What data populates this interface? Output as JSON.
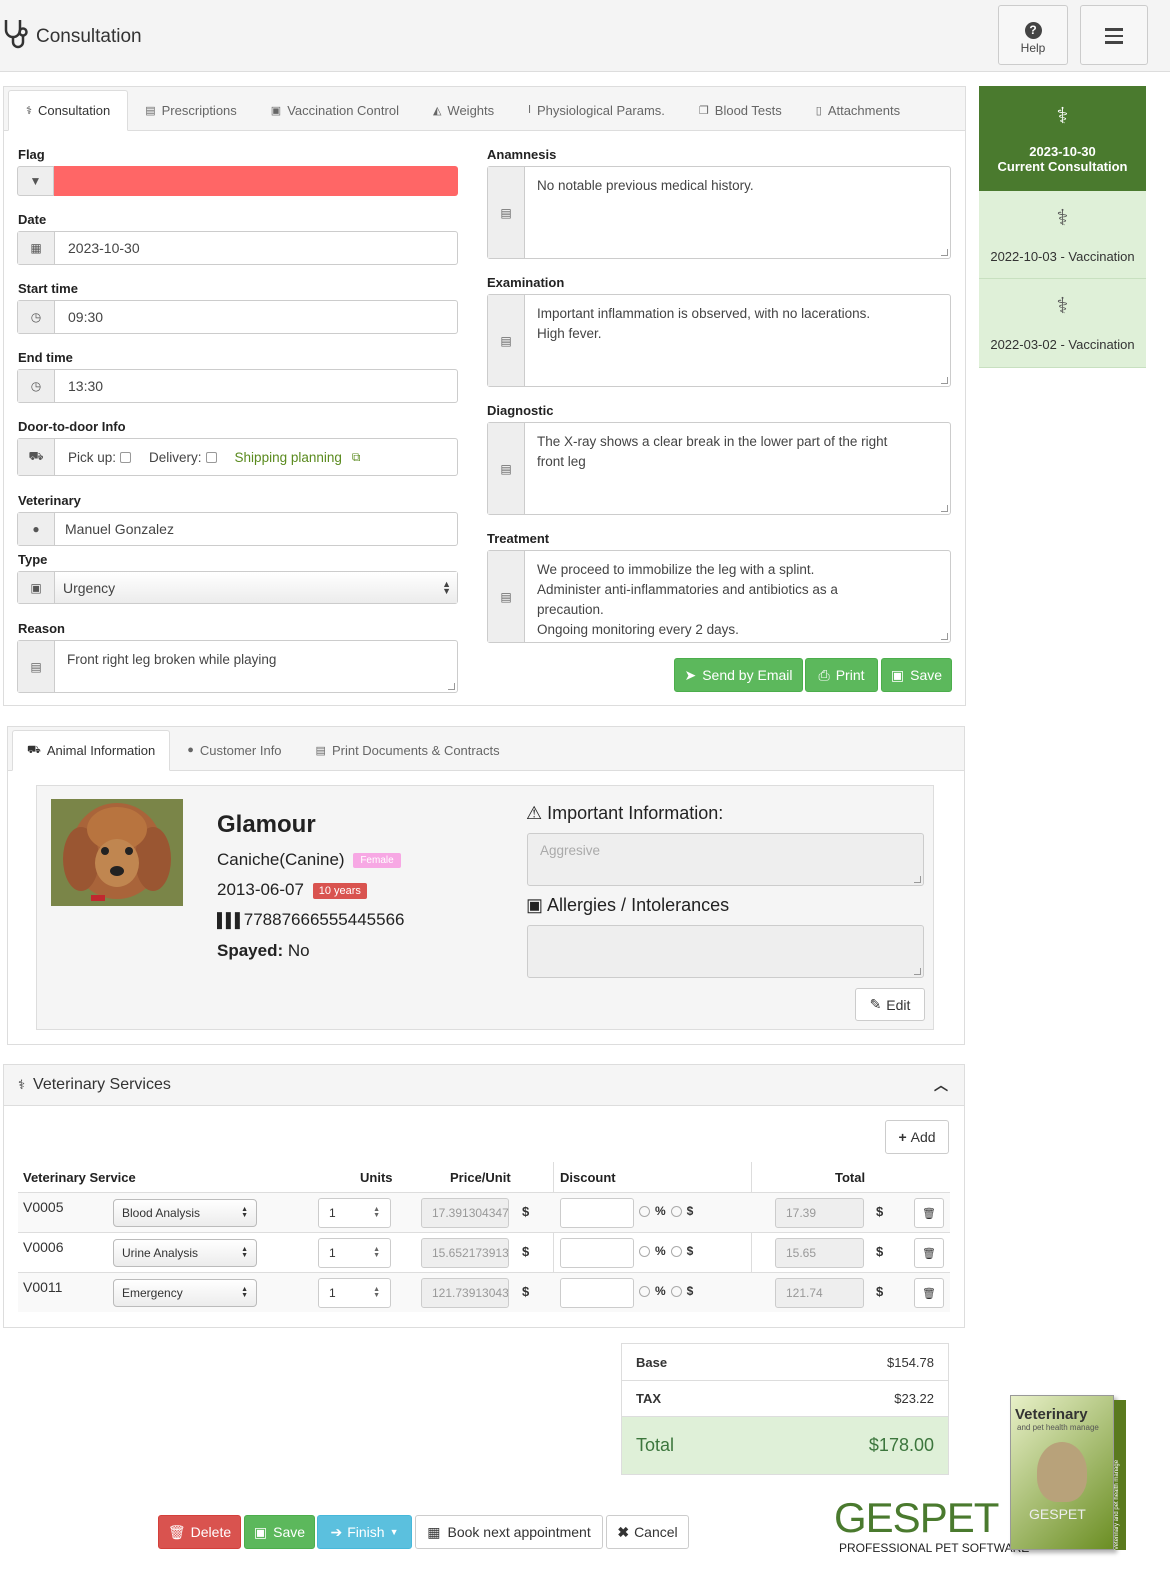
{
  "header": {
    "title": "Consultation",
    "help_label": "Help"
  },
  "tabs": [
    "Consultation",
    "Prescriptions",
    "Vaccination Control",
    "Weights",
    "Physiological Params.",
    "Blood Tests",
    "Attachments"
  ],
  "form": {
    "flag_label": "Flag",
    "flag_color": "#ff6666",
    "date_label": "Date",
    "date": "2023-10-30",
    "start_label": "Start time",
    "start": "09:30",
    "end_label": "End time",
    "end": "13:30",
    "door_label": "Door-to-door Info",
    "pickup_label": "Pick up:",
    "delivery_label": "Delivery:",
    "shipping_link": "Shipping planning",
    "vet_label": "Veterinary",
    "vet": "Manuel Gonzalez",
    "type_label": "Type",
    "type": "Urgency",
    "reason_label": "Reason",
    "reason": "Front right leg broken while playing"
  },
  "notes": {
    "anamnesis_label": "Anamnesis",
    "anamnesis": "No notable previous medical history.",
    "examination_label": "Examination",
    "examination": "Important inflammation is observed, with no lacerations.\nHigh fever.",
    "diagnostic_label": "Diagnostic",
    "diagnostic": "The X-ray shows a clear break in the lower part of the right\nfront leg",
    "treatment_label": "Treatment",
    "treatment": "We proceed to immobilize the leg with a splint.\nAdminister anti-inflammatories and antibiotics as a\nprecaution.\nOngoing monitoring every 2 days."
  },
  "actions": {
    "email": "Send by Email",
    "print": "Print",
    "save": "Save"
  },
  "history": [
    {
      "line1": "2023-10-30",
      "line2": "Current Consultation"
    },
    {
      "line1": "2022-10-03 - Vaccination"
    },
    {
      "line1": "2022-03-02 - Vaccination"
    }
  ],
  "animal_tabs": [
    "Animal Information",
    "Customer Info",
    "Print Documents & Contracts"
  ],
  "animal": {
    "name": "Glamour",
    "breed": "Caniche(Canine)",
    "sex": "Female",
    "birth": "2013-06-07",
    "age": "10 years",
    "chip": "77887666555445566",
    "spayed_label": "Spayed:",
    "spayed": "No",
    "important_label": "Important Information:",
    "important_placeholder": "Aggresive",
    "allergies_label": "Allergies / Intolerances",
    "edit": "Edit"
  },
  "services": {
    "title": "Veterinary Services",
    "add": "Add",
    "columns": [
      "Veterinary Service",
      "Units",
      "Price/Unit",
      "Discount",
      "Total"
    ],
    "rows": [
      {
        "code": "V0005",
        "name": "Blood Analysis",
        "units": "1",
        "price": "17.3913043478",
        "total": "17.39"
      },
      {
        "code": "V0006",
        "name": "Urine Analysis",
        "units": "1",
        "price": "15.6521739130",
        "total": "15.65"
      },
      {
        "code": "V0011",
        "name": "Emergency",
        "units": "1",
        "price": "121.739130434",
        "total": "121.74"
      }
    ],
    "currency": "$",
    "pct": "%"
  },
  "totals": {
    "base_label": "Base",
    "base": "$154.78",
    "tax_label": "TAX",
    "tax": "$23.22",
    "total_label": "Total",
    "total": "$178.00"
  },
  "footer": {
    "delete": "Delete",
    "save": "Save",
    "finish": "Finish",
    "book": "Book next appointment",
    "cancel": "Cancel"
  },
  "brand": {
    "name": "GESPET",
    "tagline": "PROFESSIONAL PET SOFTWARE",
    "box_title": "Veterinary",
    "box_sub": "and pet health manage",
    "box_brand": "GESPET",
    "box_side": "Veterinary and pet health manage"
  }
}
